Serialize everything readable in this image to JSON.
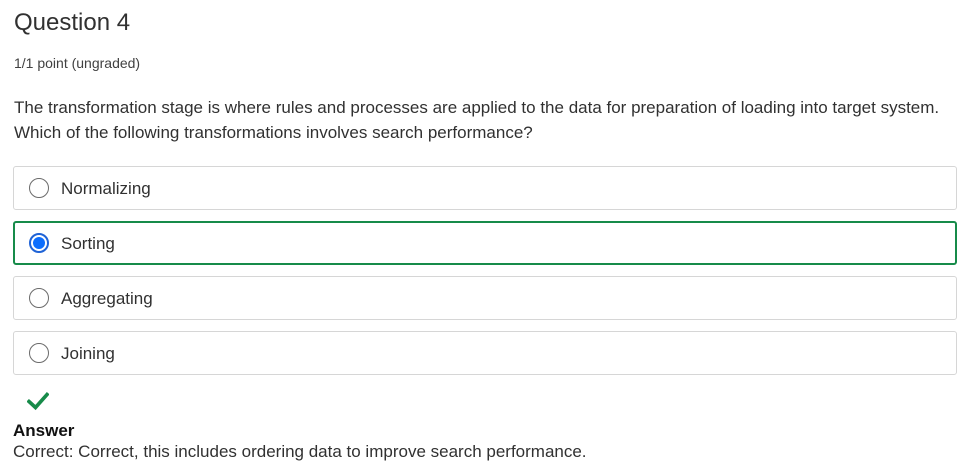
{
  "question": {
    "title": "Question 4",
    "points": "1/1 point (ungraded)",
    "prompt": "The transformation stage is where rules and processes are applied to the data for preparation of loading into target system. Which of the following transformations involves search performance?"
  },
  "choices": [
    {
      "label": "Normalizing",
      "selected": false
    },
    {
      "label": "Sorting",
      "selected": true
    },
    {
      "label": "Aggregating",
      "selected": false
    },
    {
      "label": "Joining",
      "selected": false
    }
  ],
  "result": {
    "icon": "checkmark-icon",
    "status_color": "#178b4a",
    "answer_heading": "Answer",
    "answer_text": "Correct:  Correct, this includes ordering data to improve search performance."
  },
  "colors": {
    "selected_border": "#178b4a",
    "radio_selected": "#0d6efd"
  }
}
